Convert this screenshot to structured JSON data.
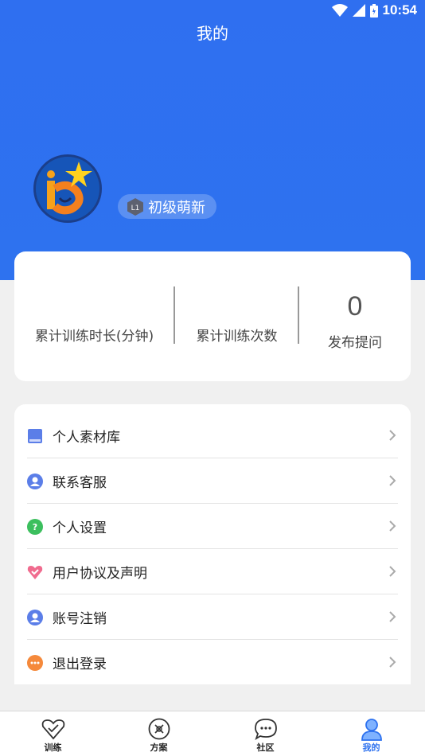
{
  "status_bar": {
    "time": "10:54"
  },
  "header": {
    "title": "我的"
  },
  "profile": {
    "level_code": "L1",
    "level_name": "初级萌新"
  },
  "stats": [
    {
      "value": "",
      "label": "累计训练时长(分钟)"
    },
    {
      "value": "",
      "label": "累计训练次数"
    },
    {
      "value": "0",
      "label": "发布提问"
    }
  ],
  "menu": {
    "items": [
      {
        "label": "个人素材库",
        "icon": "book-icon"
      },
      {
        "label": "联系客服",
        "icon": "person-icon"
      },
      {
        "label": "个人设置",
        "icon": "question-icon"
      },
      {
        "label": "用户协议及声明",
        "icon": "heart-check-icon"
      },
      {
        "label": "账号注销",
        "icon": "person-icon"
      },
      {
        "label": "退出登录",
        "icon": "chat-dots-icon"
      }
    ]
  },
  "tabbar": {
    "tabs": [
      {
        "label": "训练",
        "icon": "heart-check-icon"
      },
      {
        "label": "方案",
        "icon": "plan-icon"
      },
      {
        "label": "社区",
        "icon": "chat-icon"
      },
      {
        "label": "我的",
        "icon": "profile-icon"
      }
    ],
    "active_index": 3
  },
  "colors": {
    "primary": "#2e72ef",
    "background": "#f0f0f0"
  }
}
